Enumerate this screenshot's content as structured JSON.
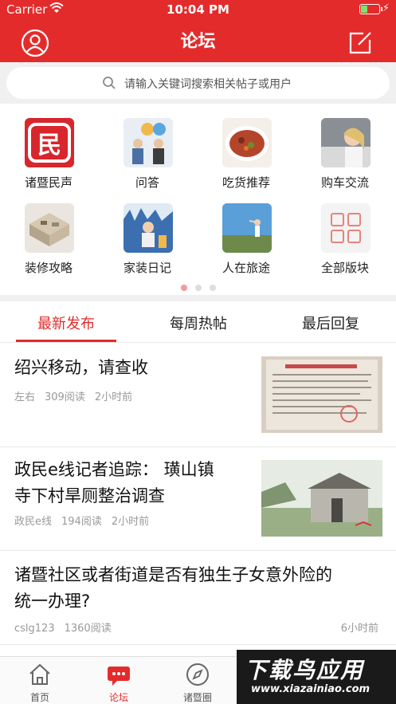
{
  "status_bar": {
    "carrier": "Carrier",
    "time": "10:04 PM",
    "battery_level": 0.3
  },
  "header": {
    "title": "论坛",
    "left_icon": "user-circle-icon",
    "right_icon": "edit-square-icon"
  },
  "search": {
    "placeholder": "请输入关键词搜索相关帖子或用户"
  },
  "categories": [
    {
      "label": "诸暨民声",
      "icon": "zhuji-minsheng-logo"
    },
    {
      "label": "问答",
      "icon": "qa-people-icon"
    },
    {
      "label": "吃货推荐",
      "icon": "food-dish-image"
    },
    {
      "label": "购车交流",
      "icon": "car-woman-image"
    },
    {
      "label": "装修攻略",
      "icon": "room-plan-image"
    },
    {
      "label": "家装日记",
      "icon": "home-decor-image"
    },
    {
      "label": "人在旅途",
      "icon": "travel-sky-image"
    },
    {
      "label": "全部版块",
      "icon": "grid-four-icon"
    }
  ],
  "pager": {
    "count": 3,
    "active_index": 0
  },
  "tabs": [
    {
      "label": "最新发布",
      "active": true
    },
    {
      "label": "每周热帖",
      "active": false
    },
    {
      "label": "最后回复",
      "active": false
    }
  ],
  "posts": [
    {
      "title": "绍兴移动，请查收",
      "author": "左右",
      "reads": "309阅读",
      "time": "2小时前",
      "thumb": "document-photo"
    },
    {
      "title_line1": "政民e线记者追踪： 璜山镇",
      "title_line2": "寺下村旱厕整治调查",
      "author": "政民e线",
      "reads": "194阅读",
      "time": "2小时前",
      "thumb": "outhouse-photo"
    },
    {
      "title_line1": "诸暨社区或者街道是否有独生子女意外险的",
      "title_line2": "统一办理?",
      "author": "cslg123",
      "reads": "1360阅读",
      "time": "6小时前"
    }
  ],
  "tabbar": [
    {
      "label": "首页",
      "icon": "home-icon",
      "active": false
    },
    {
      "label": "论坛",
      "icon": "chat-bubble-icon",
      "active": true
    },
    {
      "label": "诸暨圈",
      "icon": "compass-icon",
      "active": false
    }
  ],
  "watermark": {
    "line1": "下载鸟应用",
    "line2": "www.xiazainiao.com"
  },
  "colors": {
    "brand_red": "#e42b2b",
    "text_gray": "#999999"
  }
}
